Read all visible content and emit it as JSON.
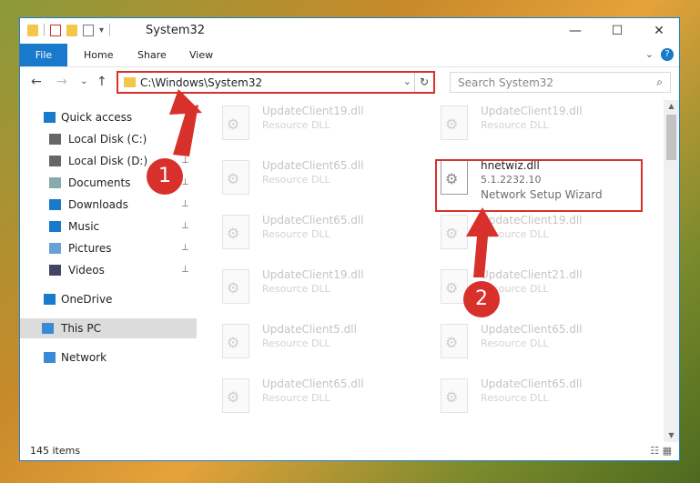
{
  "window": {
    "title": "System32",
    "controls": {
      "minimize": "—",
      "maximize": "☐",
      "close": "✕"
    },
    "qat_arrow": "▾"
  },
  "ribbon": {
    "tabs": [
      {
        "label": "File"
      },
      {
        "label": "Home"
      },
      {
        "label": "Share"
      },
      {
        "label": "View"
      }
    ],
    "expand_icon": "⌄",
    "help_icon": "?"
  },
  "nav": {
    "back": "←",
    "forward": "→",
    "recent": "⌄",
    "up": "↑"
  },
  "address": {
    "path": "C:\\Windows\\System32",
    "dropdown": "⌄",
    "refresh": "↻"
  },
  "search": {
    "placeholder": "Search System32",
    "icon": "⌕"
  },
  "sidebar": {
    "items": [
      {
        "label": "Quick access",
        "icon": "star-icon",
        "pinned": false
      },
      {
        "label": "Local Disk (C:)",
        "icon": "drive-icon",
        "pinned": true
      },
      {
        "label": "Local Disk (D:)",
        "icon": "drive-icon",
        "pinned": true
      },
      {
        "label": "Documents",
        "icon": "documents-icon",
        "pinned": true
      },
      {
        "label": "Downloads",
        "icon": "download-icon",
        "pinned": true
      },
      {
        "label": "Music",
        "icon": "music-icon",
        "pinned": true
      },
      {
        "label": "Pictures",
        "icon": "pictures-icon",
        "pinned": true
      },
      {
        "label": "Videos",
        "icon": "videos-icon",
        "pinned": true
      },
      {
        "label": "OneDrive",
        "icon": "cloud-icon",
        "pinned": false
      },
      {
        "label": "This PC",
        "icon": "computer-icon",
        "pinned": false,
        "selected": true
      },
      {
        "label": "Network",
        "icon": "network-icon",
        "pinned": false
      }
    ],
    "pin_glyph": "📌"
  },
  "files": [
    {
      "name": "UpdateClient19.dll",
      "desc": "Resource DLL"
    },
    {
      "name": "UpdateClient19.dll",
      "desc": "Resource DLL"
    },
    {
      "name": "UpdateClient65.dll",
      "desc": "Resource DLL"
    },
    {
      "name": "hnetwiz.dll",
      "desc": "5.1.2232.10",
      "desc2": "Network Setup Wizard",
      "focused": true
    },
    {
      "name": "UpdateClient65.dll",
      "desc": "Resource DLL"
    },
    {
      "name": "UpdateClient19.dll",
      "desc": "Resource DLL"
    },
    {
      "name": "UpdateClient19.dll",
      "desc": "Resource DLL"
    },
    {
      "name": "UpdateClient21.dll",
      "desc": "Resource DLL"
    },
    {
      "name": "UpdateClient5.dll",
      "desc": "Resource DLL"
    },
    {
      "name": "UpdateClient65.dll",
      "desc": "Resource DLL"
    },
    {
      "name": "UpdateClient65.dll",
      "desc": "Resource DLL"
    },
    {
      "name": "UpdateClient65.dll",
      "desc": "Resource DLL"
    }
  ],
  "status": {
    "item_count": "145 items",
    "views": "☷ ▦"
  },
  "annotations": {
    "badge1": "1",
    "badge2": "2"
  },
  "colors": {
    "accent": "#1979ca",
    "highlight": "#d8302a"
  }
}
